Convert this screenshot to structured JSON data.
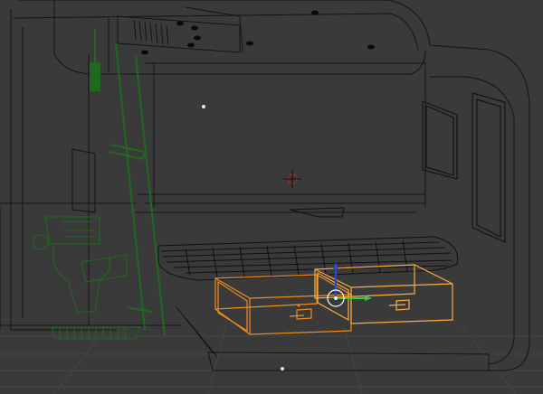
{
  "viewport": {
    "view": "user-perspective",
    "shading": "wireframe",
    "background_color": "#3a3a3a",
    "grid_color": "#454545",
    "cabin_wire_color": "#141414",
    "selected_wire_color": "#f08a1e",
    "active_wire_color": "#ffaa40",
    "fixture_wire_color": "#1f6a1f",
    "bench_wire_color": "#101010",
    "gizmo": {
      "x_axis_color": "#2ecc40",
      "y_axis_color": "#1e4fd8",
      "z_axis_color": "#d81e1e"
    },
    "cursor_3d": "3d-cursor-icon",
    "objects": [
      {
        "name": "cabin-shell",
        "selected": false
      },
      {
        "name": "ceiling-vent",
        "selected": false
      },
      {
        "name": "side-window",
        "selected": false
      },
      {
        "name": "door-panel",
        "selected": false
      },
      {
        "name": "toilet-fixture",
        "selected": false
      },
      {
        "name": "ladder-rail",
        "selected": false
      },
      {
        "name": "bench-cushion",
        "selected": false
      },
      {
        "name": "drawer-left",
        "selected": true
      },
      {
        "name": "drawer-right",
        "selected": true
      }
    ]
  }
}
